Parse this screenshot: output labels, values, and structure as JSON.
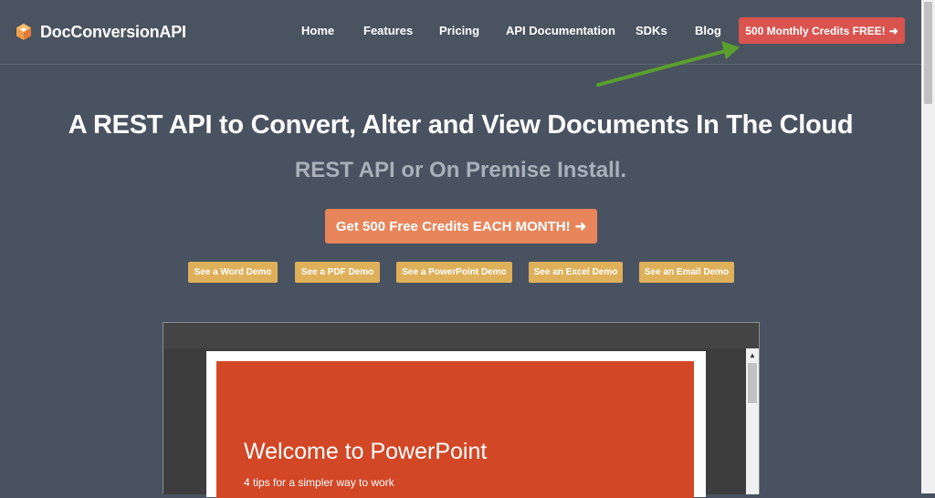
{
  "brand": {
    "name": "DocConversionAPI",
    "icon": "logo-cube-icon"
  },
  "nav": {
    "items": [
      {
        "label": "Home"
      },
      {
        "label": "Features"
      },
      {
        "label": "Pricing"
      },
      {
        "label": "API Documentation"
      },
      {
        "label": "SDKs"
      },
      {
        "label": "Blog"
      }
    ],
    "cta_label": "500 Monthly Credits FREE!",
    "cta_icon": "arrow-right-icon"
  },
  "hero": {
    "title": "A REST API to Convert, Alter and View Documents In The Cloud",
    "subtitle": "REST API or On Premise Install.",
    "cta_label": "Get 500 Free Credits EACH MONTH!"
  },
  "demos": [
    {
      "label": "See a Word Demo"
    },
    {
      "label": "See a PDF Demo"
    },
    {
      "label": "See a PowerPoint Demo"
    },
    {
      "label": "See an Excel Demo"
    },
    {
      "label": "See an Email Demo"
    }
  ],
  "viewer": {
    "slide_title": "Welcome to PowerPoint",
    "slide_subtitle": "4 tips for a simpler way to work"
  },
  "colors": {
    "background": "#495260",
    "nav_cta": "#d9534f",
    "hero_cta": "#e8855b",
    "demo_button": "#dfb05a",
    "slide": "#d24726",
    "annotation_arrow": "#5aa02c"
  }
}
